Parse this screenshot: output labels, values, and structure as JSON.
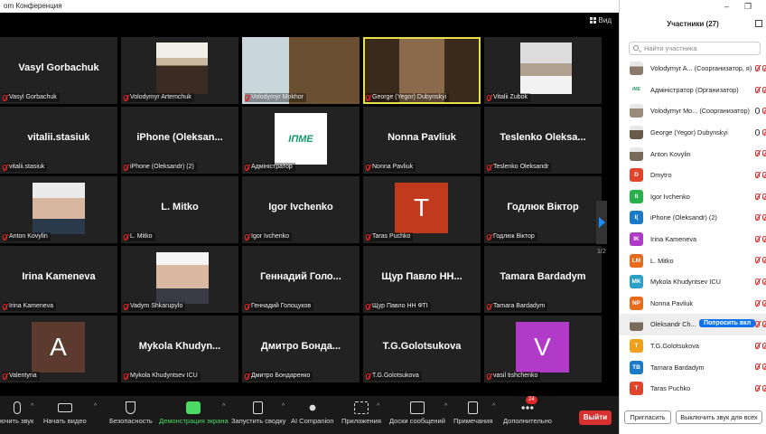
{
  "window": {
    "title": "om Конференция"
  },
  "view_label": "Вид",
  "tiles": [
    {
      "name": "Vasyl Gorbachuk",
      "label": "Vasyl Gorbachuk",
      "kind": "name",
      "cut": true
    },
    {
      "name": "",
      "label": "Volodymyr Artemchuk",
      "kind": "video"
    },
    {
      "name": "",
      "label": "Volodymyr Mokhor",
      "kind": "video"
    },
    {
      "name": "",
      "label": "George (Yegor) Dubynskyi",
      "kind": "video",
      "active": true
    },
    {
      "name": "",
      "label": "Vitalii Zubok",
      "kind": "video"
    },
    {
      "name": "vitalii.stasiuk",
      "label": "vitalii.stasiuk",
      "kind": "name",
      "cut": true
    },
    {
      "name": "iPhone  (Oleksan...",
      "label": "iPhone (Oleksandr) (2)",
      "kind": "name"
    },
    {
      "name": "",
      "label": "Адміністратор",
      "kind": "logo",
      "logo_text": "ІПМЕ"
    },
    {
      "name": "Nonna Pavliuk",
      "label": "Nonna Pavliuk",
      "kind": "name"
    },
    {
      "name": "Teslenko  Oleksa...",
      "label": "Teslenko Oleksandr",
      "kind": "name"
    },
    {
      "name": "",
      "label": "Anton Kovylin",
      "kind": "video",
      "cut": true
    },
    {
      "name": "L. Mitko",
      "label": "L. Mitko",
      "kind": "name"
    },
    {
      "name": "Igor Ivchenko",
      "label": "Igor Ivchenko",
      "kind": "name"
    },
    {
      "name": "",
      "label": "Taras Puchko",
      "kind": "avatar",
      "letter": "T",
      "color": "#c23a1e"
    },
    {
      "name": "Годлюк Віктор",
      "label": "Годлюк Віктор",
      "kind": "name"
    },
    {
      "name": "Irina Kameneva",
      "label": "Irina Kameneva",
      "kind": "name",
      "cut": true
    },
    {
      "name": "",
      "label": "Vadym Shkarupylo",
      "kind": "video"
    },
    {
      "name": "Геннадий  Голо...",
      "label": "Геннадий Голоцуков",
      "kind": "name"
    },
    {
      "name": "Щур Павло НН...",
      "label": "Щур Павло НН ФТІ",
      "kind": "name"
    },
    {
      "name": "Tamara Bardadym",
      "label": "Tamara Bardadym",
      "kind": "name"
    },
    {
      "name": "",
      "label": "Valentyna",
      "kind": "avatar",
      "letter": "A",
      "color": "#5c3a2e",
      "cut": true
    },
    {
      "name": "Mykola  Khudyn...",
      "label": "Mykola Khudyntsev ICU",
      "kind": "name"
    },
    {
      "name": "Дмитро  Бонда...",
      "label": "Дмитро Бондаренко",
      "kind": "name"
    },
    {
      "name": "T.G.Golotsukova",
      "label": "T.G.Golotsukova",
      "kind": "name"
    },
    {
      "name": "",
      "label": "vasil tishchenko",
      "kind": "avatar",
      "letter": "V",
      "color": "#b23ac8"
    }
  ],
  "pager": {
    "indicator": "1/2"
  },
  "toolbar": {
    "items": [
      {
        "key": "unmute",
        "label": "ючить звук",
        "icon": "mic-off-icon"
      },
      {
        "key": "video",
        "label": "Начать видео",
        "icon": "video-off-icon"
      },
      {
        "key": "security",
        "label": "Безопасность",
        "icon": "shield-icon"
      },
      {
        "key": "share",
        "label": "Демонстрация экрана",
        "icon": "share-screen-icon",
        "green": true
      },
      {
        "key": "summary",
        "label": "Запустить сводку",
        "icon": "summary-icon"
      },
      {
        "key": "ai",
        "label": "AI Companion",
        "icon": "sparkle-icon"
      },
      {
        "key": "apps",
        "label": "Приложения",
        "icon": "apps-icon"
      },
      {
        "key": "whiteboards",
        "label": "Доски сообщений",
        "icon": "whiteboard-icon"
      },
      {
        "key": "notes",
        "label": "Примечания",
        "icon": "notes-icon"
      },
      {
        "key": "more",
        "label": "Дополнительно",
        "icon": "more-icon",
        "badge": "24"
      }
    ],
    "exit_label": "Выйти"
  },
  "panel": {
    "title": "Участники (27)",
    "search_placeholder": "Найти участника",
    "participants": [
      {
        "name": "Volodymyr A... (Соорганизатор, я)",
        "initials": "",
        "color": "#8a7a6a",
        "photo": true,
        "mic": "off"
      },
      {
        "name": "Адміністратор (Организатор)",
        "initials": "",
        "color": "#2a9a6a",
        "logo": true,
        "mic": "off"
      },
      {
        "name": "Volodymyr Mo... (Соорганизатор)",
        "initials": "",
        "color": "#9a8a7a",
        "photo": true,
        "mic": "on"
      },
      {
        "name": "George (Yegor) Dubynskyi",
        "initials": "",
        "color": "#6a5a4a",
        "photo": true,
        "mic": "on"
      },
      {
        "name": "Anton Kovylin",
        "initials": "",
        "color": "#7a6a5a",
        "photo": true,
        "mic": "off"
      },
      {
        "name": "Dmytro",
        "initials": "D",
        "color": "#e0442a",
        "mic": "off"
      },
      {
        "name": "Igor Ivchenko",
        "initials": "II",
        "color": "#2ab04a",
        "mic": "off"
      },
      {
        "name": "iPhone (Oleksandr) (2)",
        "initials": "I(",
        "color": "#1a7ac8",
        "mic": "off"
      },
      {
        "name": "Irina Kameneva",
        "initials": "IK",
        "color": "#b03ac8",
        "mic": "off"
      },
      {
        "name": "L. Mitko",
        "initials": "LM",
        "color": "#e86a1a",
        "mic": "off"
      },
      {
        "name": "Mykola Khudyntsev ICU",
        "initials": "MK",
        "color": "#2aa0c8",
        "mic": "off"
      },
      {
        "name": "Nonna Pavliuk",
        "initials": "NP",
        "color": "#e86a1a",
        "mic": "off"
      },
      {
        "name": "Oleksandr Ch...",
        "initials": "",
        "color": "#7a6a5a",
        "photo": true,
        "mic": "off",
        "hover": true,
        "ask_label": "Попросить вкл"
      },
      {
        "name": "T.G.Golotsukova",
        "initials": "T",
        "color": "#f0a01a",
        "mic": "off"
      },
      {
        "name": "Tamara Bardadym",
        "initials": "TB",
        "color": "#1a7ac8",
        "mic": "off"
      },
      {
        "name": "Taras Puchko",
        "initials": "T",
        "color": "#e0442a",
        "mic": "off"
      }
    ],
    "invite_label": "Пригласить",
    "mute_all_label": "Выключить звук для всех"
  }
}
